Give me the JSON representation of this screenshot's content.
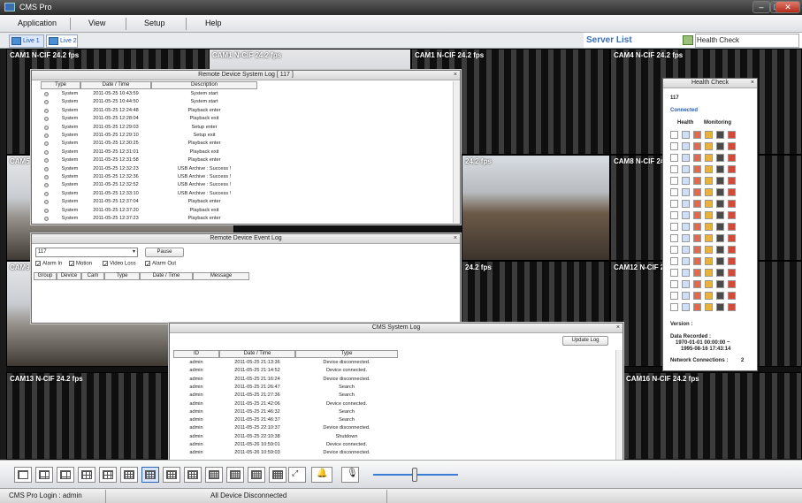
{
  "window": {
    "title": "CMS Pro"
  },
  "menu": [
    "Application",
    "View",
    "Setup",
    "Help"
  ],
  "tabs": [
    "Live 1",
    "Live 2"
  ],
  "server_panel": {
    "title": "Server List",
    "health_tab": "Health Check"
  },
  "cameras": [
    {
      "label": "CAM1 N-CIF 24.2 fps"
    },
    {
      "label": "CAM1 N-CIF 24.2 fps"
    },
    {
      "label": "CAM1 N-CIF 24.2 fps"
    },
    {
      "label": "CAM4 N-CIF 24.2 fps"
    },
    {
      "label": "CAM5"
    },
    {
      "label": "24.2 fps"
    },
    {
      "label": "CAM8 N-CIF 24.2"
    },
    {
      "label": "CAM9"
    },
    {
      "label": "24.2 fps"
    },
    {
      "label": "CAM12 N-CIF 24.2"
    },
    {
      "label": "CAM13 N-CIF 24.2 fps"
    },
    {
      "label": "CAM16 N-CIF 24.2 fps"
    }
  ],
  "system_log": {
    "title": "Remote Device System Log  [ 117 ]",
    "headers": [
      "Type",
      "Date / Time",
      "Description"
    ],
    "rows": [
      [
        "System",
        "2011-05-25 10:43:59",
        "System start"
      ],
      [
        "System",
        "2011-05-25 10:44:50",
        "System start"
      ],
      [
        "System",
        "2011-05-25 12:24:48",
        "Playback enter"
      ],
      [
        "System",
        "2011-05-25 12:28:04",
        "Playback exit"
      ],
      [
        "System",
        "2011-05-25 12:29:03",
        "Setup enter"
      ],
      [
        "System",
        "2011-05-25 12:29:10",
        "Setup exit"
      ],
      [
        "System",
        "2011-05-25 12:30:25",
        "Playback enter"
      ],
      [
        "System",
        "2011-05-25 12:31:01",
        "Playback exit"
      ],
      [
        "System",
        "2011-05-25 12:31:58",
        "Playback enter"
      ],
      [
        "System",
        "2011-05-25 12:32:23",
        "USB Archive : Success !"
      ],
      [
        "System",
        "2011-05-25 12:32:36",
        "USB Archive : Success !"
      ],
      [
        "System",
        "2011-05-25 12:32:52",
        "USB Archive : Success !"
      ],
      [
        "System",
        "2011-05-25 12:33:10",
        "USB Archive : Success !"
      ],
      [
        "System",
        "2011-05-25 12:37:04",
        "Playback enter"
      ],
      [
        "System",
        "2011-05-25 12:37:20",
        "Playback exit"
      ],
      [
        "System",
        "2011-05-25 12:37:23",
        "Playback enter"
      ]
    ]
  },
  "event_log": {
    "title": "Remote Device Event Log",
    "device_value": "117",
    "pause_label": "Pause",
    "filters": [
      "Alarm In",
      "Motion",
      "Video Loss",
      "Alarm Out"
    ],
    "headers": [
      "Group",
      "Device",
      "Cam",
      "Type",
      "Date / Time",
      "Message"
    ]
  },
  "cms_log": {
    "title": "CMS System Log",
    "update_label": "Update Log",
    "headers": [
      "ID",
      "Date / Time",
      "Type"
    ],
    "rows": [
      [
        "admin",
        "2011-05-25 21:13:36",
        "Device disconnected."
      ],
      [
        "admin",
        "2011-05-25 21:14:52",
        "Device connected."
      ],
      [
        "admin",
        "2011-05-25 21:16:24",
        "Device disconnected."
      ],
      [
        "admin",
        "2011-05-25 21:26:47",
        "Search"
      ],
      [
        "admin",
        "2011-05-25 21:27:36",
        "Search"
      ],
      [
        "admin",
        "2011-05-25 21:42:06",
        "Device connected."
      ],
      [
        "admin",
        "2011-05-25 21:46:32",
        "Search"
      ],
      [
        "admin",
        "2011-05-25 21:46:37",
        "Search"
      ],
      [
        "admin",
        "2011-05-25 22:10:37",
        "Device disconnected."
      ],
      [
        "admin",
        "2011-05-25 22:10:38",
        "Shutdown"
      ],
      [
        "admin",
        "2011-05-26 10:59:01",
        "Device connected."
      ],
      [
        "admin",
        "2011-05-26 10:59:03",
        "Device disconnected."
      ]
    ]
  },
  "health": {
    "title": "Health Check",
    "device": "117",
    "state": "Connected",
    "col_health": "Health",
    "col_monitoring": "Monitoring",
    "version_label": "Version :",
    "recorded_label": "Data Recorded :",
    "recorded_from": "1970-01-01 00:00:00 ~",
    "recorded_to": "1995-08-16 17:43:14",
    "net_label": "Network Connections :",
    "net_value": "2"
  },
  "status": {
    "login": "CMS Pro Login : admin",
    "message": "All Device Disconnected"
  },
  "colors": {
    "accent": "#3d6fb4",
    "selected": "#d6e5fb"
  }
}
